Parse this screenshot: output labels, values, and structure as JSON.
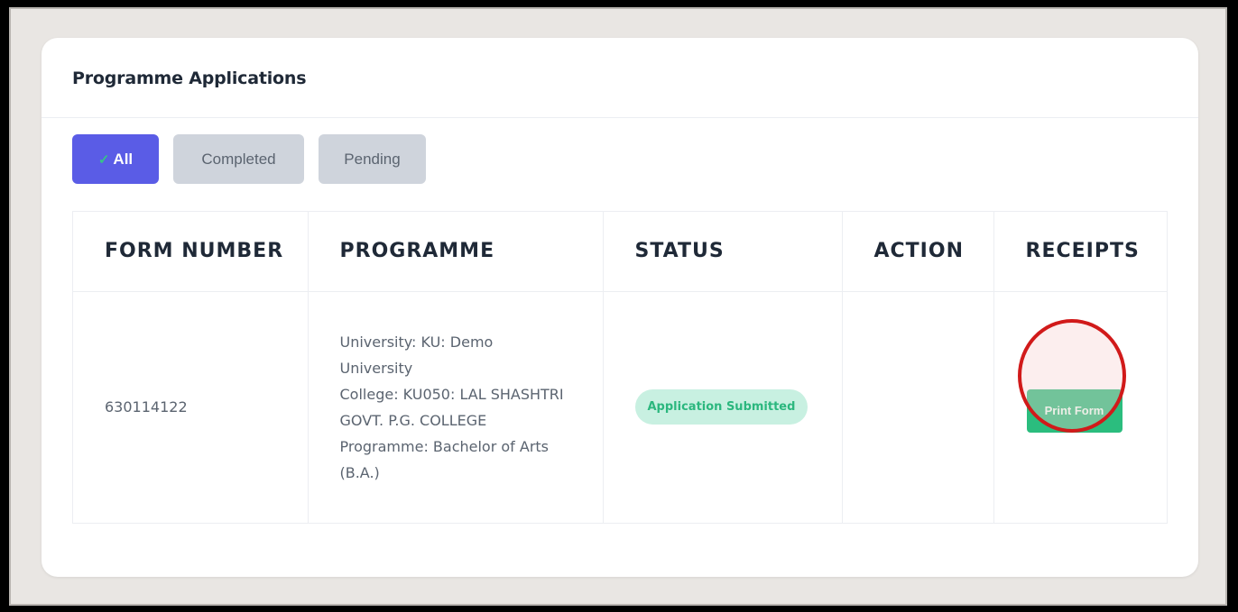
{
  "card": {
    "title": "Programme Applications"
  },
  "filters": [
    {
      "label": "All",
      "active": true
    },
    {
      "label": "Completed",
      "active": false
    },
    {
      "label": "Pending",
      "active": false
    }
  ],
  "table": {
    "headers": [
      "FORM NUMBER",
      "PROGRAMME",
      "STATUS",
      "ACTION",
      "RECEIPTS"
    ],
    "rows": [
      {
        "form_number": "630114122",
        "programme": {
          "university": "University: KU: Demo University",
          "college": "College: KU050: LAL SHASHTRI GOVT. P.G. COLLEGE",
          "programme": "Programme: Bachelor of Arts (B.A.)"
        },
        "status": "Application Submitted",
        "action": "",
        "receipt_button": "Print Form"
      }
    ]
  },
  "icons": {
    "filter_active": "check-icon"
  },
  "colors": {
    "accent": "#5a5ce6",
    "success": "#2bbd7e",
    "status_bg": "#c8f0e1",
    "highlight": "#d11a1a"
  }
}
